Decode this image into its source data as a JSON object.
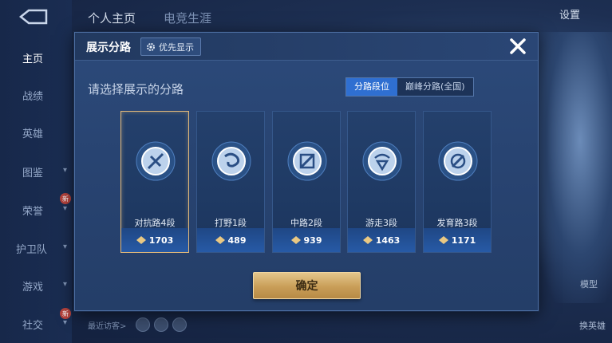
{
  "nav": {
    "items": [
      {
        "label": "主页",
        "chev": false
      },
      {
        "label": "战绩",
        "chev": false
      },
      {
        "label": "英雄",
        "chev": false
      },
      {
        "label": "图鉴",
        "chev": true
      },
      {
        "label": "荣誉",
        "chev": true
      },
      {
        "label": "护卫队",
        "chev": true
      },
      {
        "label": "游戏",
        "chev": true
      },
      {
        "label": "社交",
        "chev": true
      }
    ],
    "badge_new": "新"
  },
  "top_tabs": {
    "profile": "个人主页",
    "esports": "电竞生涯"
  },
  "settings_label": "设置",
  "right_panel": {
    "model": "模型",
    "change_hero": "换英雄"
  },
  "visitors_label": "最近访客>",
  "modal": {
    "title": "展示分路",
    "priority_label": "优先显示",
    "subtitle": "请选择展示的分路",
    "segments": [
      {
        "label": "分路段位",
        "active": true
      },
      {
        "label": "巅峰分路(全国)",
        "active": false
      }
    ],
    "cards": [
      {
        "label": "对抗路4段",
        "points": "1703",
        "icon": "sword-emblem-icon",
        "selected": true
      },
      {
        "label": "打野1段",
        "points": "489",
        "icon": "swirl-emblem-icon",
        "selected": false
      },
      {
        "label": "中路2段",
        "points": "939",
        "icon": "staff-emblem-icon",
        "selected": false
      },
      {
        "label": "游走3段",
        "points": "1463",
        "icon": "shield-emblem-icon",
        "selected": false
      },
      {
        "label": "发育路3段",
        "points": "1171",
        "icon": "arrow-emblem-icon",
        "selected": false
      }
    ],
    "confirm_label": "确定"
  },
  "colors": {
    "accent_blue": "#2f6fd1",
    "gold": "#e3b97a",
    "card_bg": "#24406c"
  }
}
